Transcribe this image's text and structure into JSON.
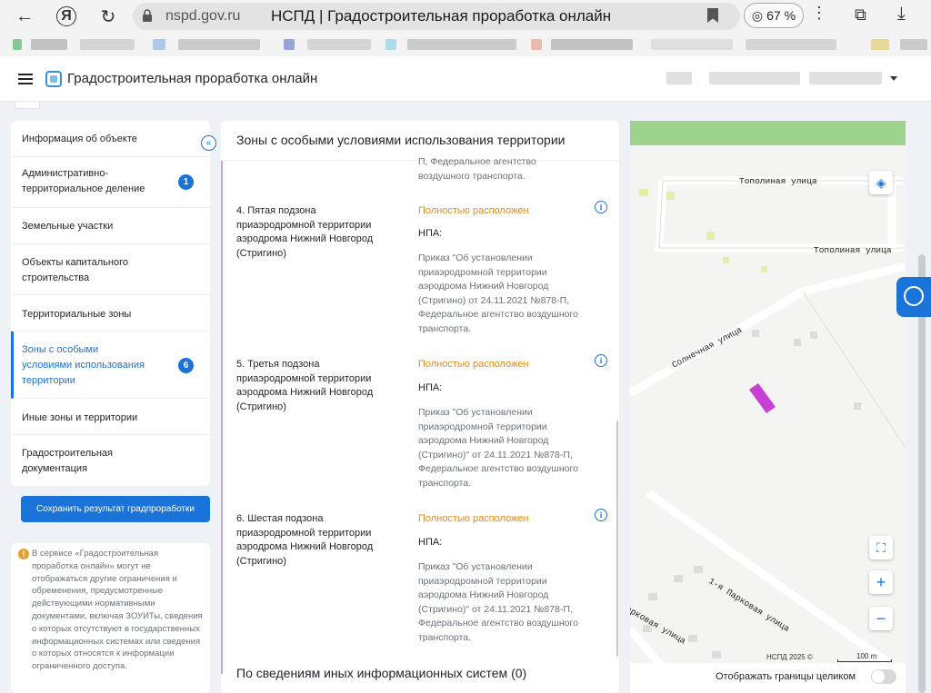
{
  "browser": {
    "host": "nspd.gov.ru",
    "page_title": "НСПД | Градостроительная проработка онлайн",
    "zoom": "67 %"
  },
  "header": {
    "title": "Градостроительная проработка онлайн"
  },
  "sidebar": {
    "items": [
      {
        "label": "Информация об объекте",
        "badge": ""
      },
      {
        "label": "Административно-\nтерриториальное деление",
        "badge": "1"
      },
      {
        "label": "Земельные участки",
        "badge": ""
      },
      {
        "label": "Объекты капитального\nстроительства",
        "badge": ""
      },
      {
        "label": "Территориальные зоны",
        "badge": ""
      },
      {
        "label": "Зоны с особыми\nусловиями использования\nтерритории",
        "badge": "6"
      },
      {
        "label": "Иные зоны и территории",
        "badge": ""
      },
      {
        "label": "Градостроительная\nдокументация",
        "badge": ""
      }
    ],
    "save_button": "Сохранить результат градпроработки",
    "notice": "В сервисе «Градостроительная проработка онлайн» могут не отображаться другие ограничения и обременения, предусмотренные действующими нормативными документами, включая ЗОУИТы, сведения о которых отсутствуют в государственных информационных системах или сведения о которых относятся к информации ограниченного доступа."
  },
  "zones_panel": {
    "title": "Зоны с особыми условиями использования территории",
    "top_cut_text": "П, Федеральное агентство\nвоздушного транспорта.",
    "zones": [
      {
        "name": "4. Пятая подзона приаэродромной территории аэродрома Нижний Новгород (Стригино)",
        "status": "Полностью расположен",
        "npa_label": "НПА:",
        "doc": "Приказ \"Об установлении приаэродромной территории аэродрома Нижний Новгород (Стригино) от 24.11.2021 №878-П, Федеральное агентство воздушного транспорта."
      },
      {
        "name": "5. Третья подзона приаэродромной территории аэродрома Нижний Новгород (Стригино)",
        "status": "Полностью расположен",
        "npa_label": "НПА:",
        "doc": "Приказ \"Об установлении приаэродромной территории аэродрома Нижний Новгород (Стригино)\" от 24.11.2021 №878-П, Федеральное агентство воздушного транспорта."
      },
      {
        "name": "6. Шестая подзона приаэродромной территории аэродрома Нижний Новгород (Стригино)",
        "status": "Полностью расположен",
        "npa_label": "НПА:",
        "doc": "Приказ \"Об установлении приаэродромной территории аэродрома Нижний Новгород (Стригино)\" от 24.11.2021 №878-П, Федеральное агентство воздушного транспорта."
      }
    ],
    "footer_title": "По сведениям иных информационных систем (0)"
  },
  "map": {
    "streets": [
      "Тополиная улица",
      "Тополиная улица",
      "Солнечная улица",
      "1-я Парковая улица",
      "Парковая улица"
    ],
    "copyright": "НСПД 2025 ©",
    "scale": "100 m",
    "toggle_label": "Отображать границы целиком",
    "parcel_color": "#c640d6"
  }
}
